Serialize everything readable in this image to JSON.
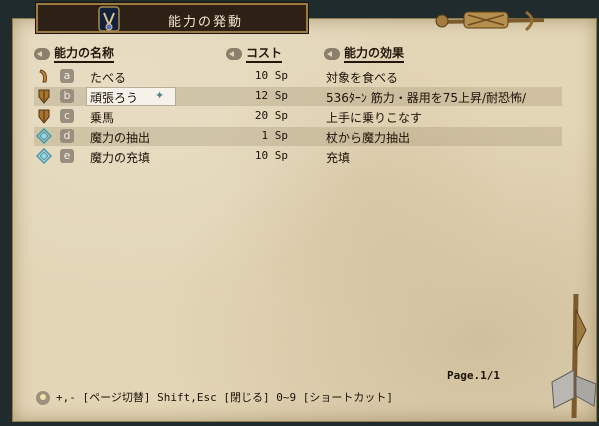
{
  "window": {
    "title": "能力の発動"
  },
  "headers": {
    "name": "能力の名称",
    "cost": "コスト",
    "effect": "能力の効果"
  },
  "abilities": [
    {
      "key": "a",
      "name": "たべる",
      "cost": "10 Sp",
      "effect": "対象を食べる",
      "icon": "horn-icon"
    },
    {
      "key": "b",
      "name": "頑張ろう",
      "cost": "12 Sp",
      "effect": "536ﾀｰﾝ 筋力・器用を75上昇/耐恐怖/",
      "icon": "shield-icon"
    },
    {
      "key": "c",
      "name": "乗馬",
      "cost": "20 Sp",
      "effect": "上手に乗りこなす",
      "icon": "shield-icon"
    },
    {
      "key": "d",
      "name": "魔力の抽出",
      "cost": " 1 Sp",
      "effect": "杖から魔力抽出",
      "icon": "diamond-rune-icon"
    },
    {
      "key": "e",
      "name": "魔力の充填",
      "cost": "10 Sp",
      "effect": "充填",
      "icon": "diamond-rune-icon"
    }
  ],
  "page": "Page.1/1",
  "footer": "+,- [ページ切替]  Shift,Esc [閉じる]  0~9 [ショートカット]"
}
